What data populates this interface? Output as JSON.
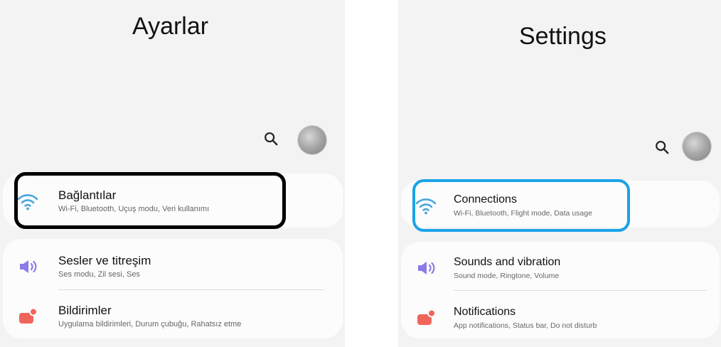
{
  "left_panel": {
    "title": "Ayarlar",
    "items": [
      {
        "title": "Bağlantılar",
        "subtitle": "Wi-Fi, Bluetooth, Uçuş modu, Veri kullanımı",
        "icon": "wifi-icon"
      },
      {
        "title": "Sesler ve titreşim",
        "subtitle": "Ses modu, Zil sesi, Ses",
        "icon": "volume-icon"
      },
      {
        "title": "Bildirimler",
        "subtitle": "Uygulama bildirimleri, Durum çubuğu, Rahatsız etme",
        "icon": "notification-icon"
      }
    ]
  },
  "right_panel": {
    "title": "Settings",
    "items": [
      {
        "title": "Connections",
        "subtitle": "Wi-Fi, Bluetooth, Flight mode, Data usage",
        "icon": "wifi-icon"
      },
      {
        "title": "Sounds and vibration",
        "subtitle": "Sound mode, Ringtone, Volume",
        "icon": "volume-icon"
      },
      {
        "title": "Notifications",
        "subtitle": "App notifications, Status bar, Do not disturb",
        "icon": "notification-icon"
      }
    ]
  },
  "colors": {
    "panel_background": "#f3f3f3",
    "card_background": "#fcfcfc",
    "wifi_icon": "#4aa6dc",
    "volume_icon": "#8a7be6",
    "notification_icon": "#f0655a",
    "left_highlight": "#000000",
    "right_highlight": "#1aa3e8"
  }
}
